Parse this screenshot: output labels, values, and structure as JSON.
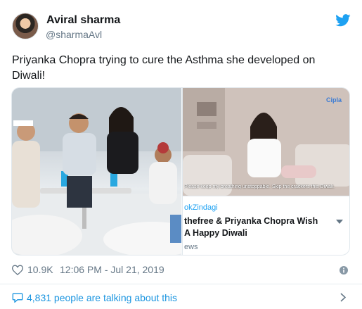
{
  "author": {
    "name": "Aviral sharma",
    "handle": "@sharmaAvl"
  },
  "tweet": {
    "text": "Priyanka Chopra trying to cure the Asthma she developed on Diwali!"
  },
  "card": {
    "brand": "Cipla",
    "subtitle": "Please keep my breathing unstoppable. Skip the crackers this Diwali.",
    "source": "okZindagi",
    "title": "thefree & Priyanka Chopra Wish A Happy Diwali",
    "footer": "ews"
  },
  "meta": {
    "likes": "10.9K",
    "timestamp": "12:06 PM - Jul 21, 2019"
  },
  "talking": {
    "text": "4,831 people are talking about this"
  },
  "colors": {
    "twitter_blue": "#1da1f2",
    "link_blue": "#1b95e0",
    "muted": "#657786"
  },
  "icons": {
    "logo": "twitter-bird-icon",
    "like": "heart-icon",
    "info": "info-icon",
    "comment": "comment-icon",
    "chevron": "chevron-right-icon"
  }
}
